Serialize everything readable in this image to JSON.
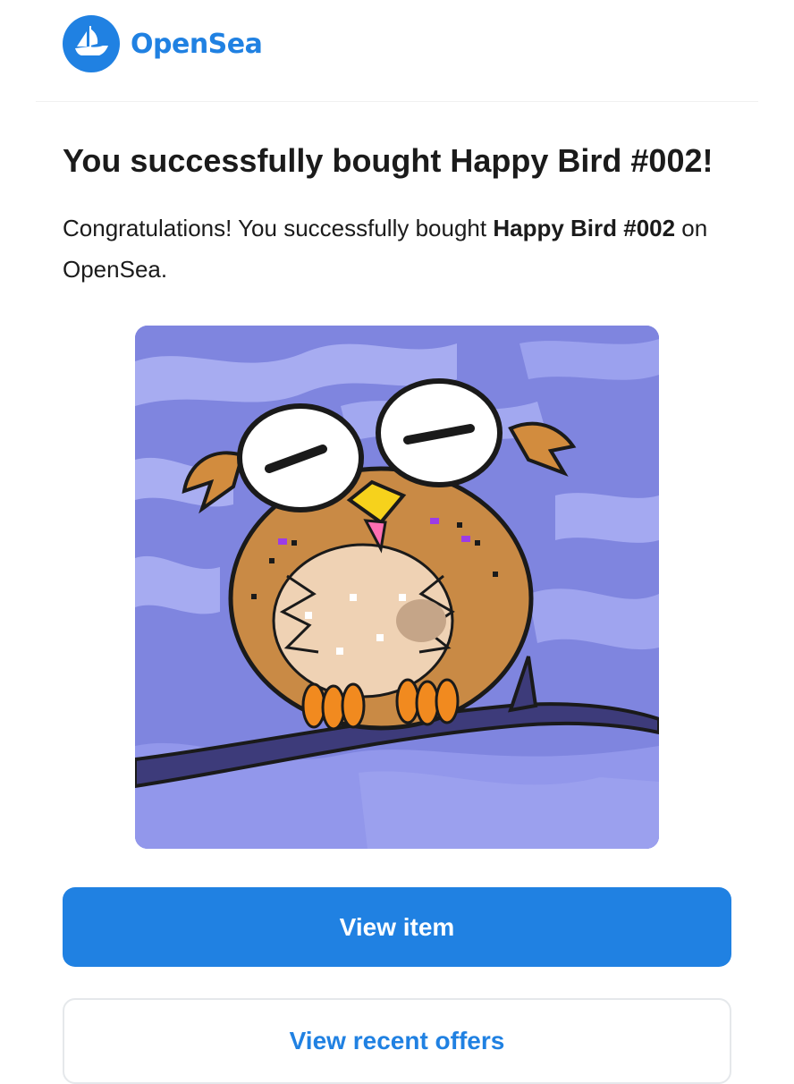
{
  "brand": {
    "name": "OpenSea",
    "logo_icon": "opensea-ship-icon",
    "color": "#2081e2"
  },
  "email": {
    "title": "You successfully bought Happy Bird #002!",
    "message_prefix": "Congratulations! You successfully bought ",
    "item_name": "Happy Bird #002",
    "message_suffix": " on OpenSea."
  },
  "nft_image": {
    "icon": "owl-nft-image",
    "background_color": "#7f85df"
  },
  "buttons": {
    "view_item": "View item",
    "view_offers": "View recent offers"
  }
}
